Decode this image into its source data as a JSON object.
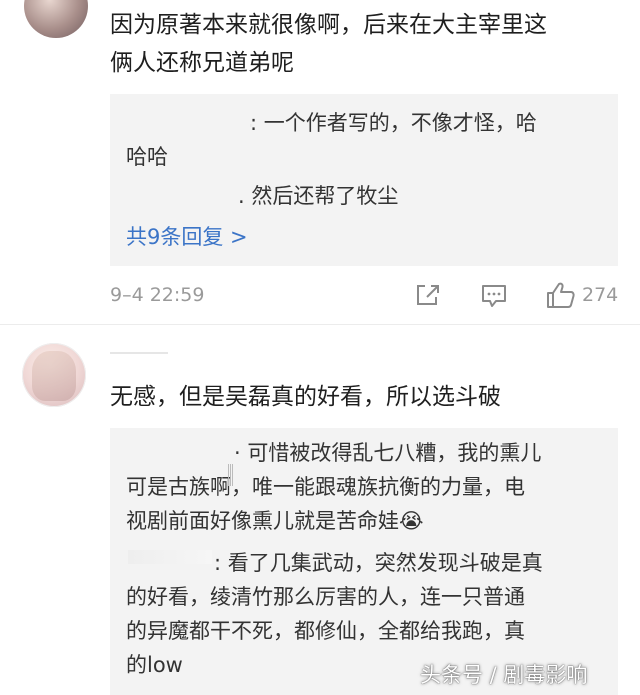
{
  "comment1": {
    "text_line1": "因为原著本来就很像啊，后来在大主宰里这",
    "text_line2": "俩人还称兄道弟呢",
    "replies": [
      {
        "text_line1": ": 一个作者写的，不像才怪，哈",
        "text_line2": "哈哈"
      },
      {
        "text_line1": ". 然后还帮了牧尘"
      }
    ],
    "more_replies": "共9条回复 >",
    "timestamp": "9–4 22:59",
    "like_count": "274"
  },
  "comment2": {
    "text": "无感，但是吴磊真的好看，所以选斗破",
    "replies": [
      {
        "lines": [
          "· 可惜被改得乱七八糟，我的熏儿",
          "可是古族啊，唯一能跟魂族抗衡的力量，电",
          "视剧前面好像熏儿就是苦命娃😭"
        ]
      },
      {
        "lines": [
          ": 看了几集武动，突然发现斗破是真",
          "的好看，绫清竹那么厉害的人，连一只普通",
          "的异魔都干不死，都修仙，全都给我跑，真",
          "的low"
        ]
      }
    ]
  },
  "icons": {
    "forward": "share-edit-icon",
    "comment": "comment-icon",
    "like": "thumbs-up-icon"
  },
  "watermark": "头条号 / 剧毒影响"
}
